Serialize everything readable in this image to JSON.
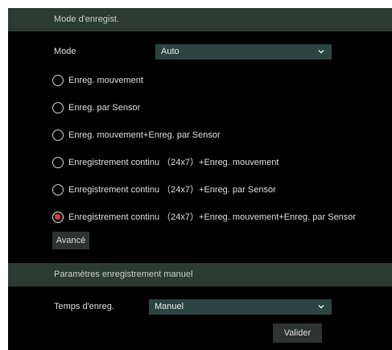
{
  "recording_mode": {
    "header": "Mode d'enregist.",
    "mode_label": "Mode",
    "mode_value": "Auto",
    "options": [
      {
        "label": "Enreg. mouvement",
        "checked": false
      },
      {
        "label": "Enreg. par Sensor",
        "checked": false
      },
      {
        "label": "Enreg. mouvement+Enreg. par Sensor",
        "checked": false
      },
      {
        "label": "Enregistrement continu （24x7）+Enreg. mouvement",
        "checked": false
      },
      {
        "label": "Enregistrement continu （24x7）+Enreg. par Sensor",
        "checked": false
      },
      {
        "label": "Enregistrement continu （24x7）+Enreg. mouvement+Enreg. par Sensor",
        "checked": true
      }
    ],
    "advanced_label": "Avancé"
  },
  "manual_recording": {
    "header": "Paramètres enregistrement manuel",
    "time_label": "Temps d'enreg.",
    "time_value": "Manuel",
    "validate_label": "Valider"
  },
  "colors": {
    "panel_bg": "#000000",
    "header_bg": "#2c3a34",
    "select_bg": "#2b4441",
    "radio_checked": "#e23a35"
  }
}
